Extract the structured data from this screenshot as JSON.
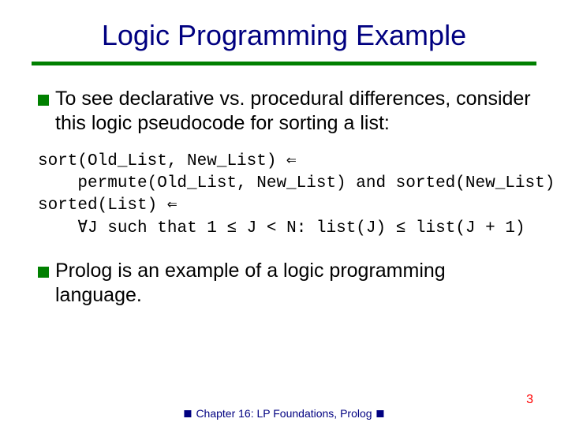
{
  "title": "Logic Programming Example",
  "bullets": {
    "b1": "To see declarative vs. procedural differences, consider this logic pseudocode for sorting a list:",
    "b2": "Prolog is an example of a logic programming language."
  },
  "code": {
    "l1": "sort(Old_List, New_List) ⇐",
    "l2": "    permute(Old_List, New_List) and sorted(New_List)",
    "l3": "sorted(List) ⇐",
    "l4": "    ∀J such that 1 ≤ J < N: list(J) ≤ list(J + 1)"
  },
  "footer": {
    "text": "Chapter 16: LP Foundations, Prolog",
    "page": "3"
  }
}
